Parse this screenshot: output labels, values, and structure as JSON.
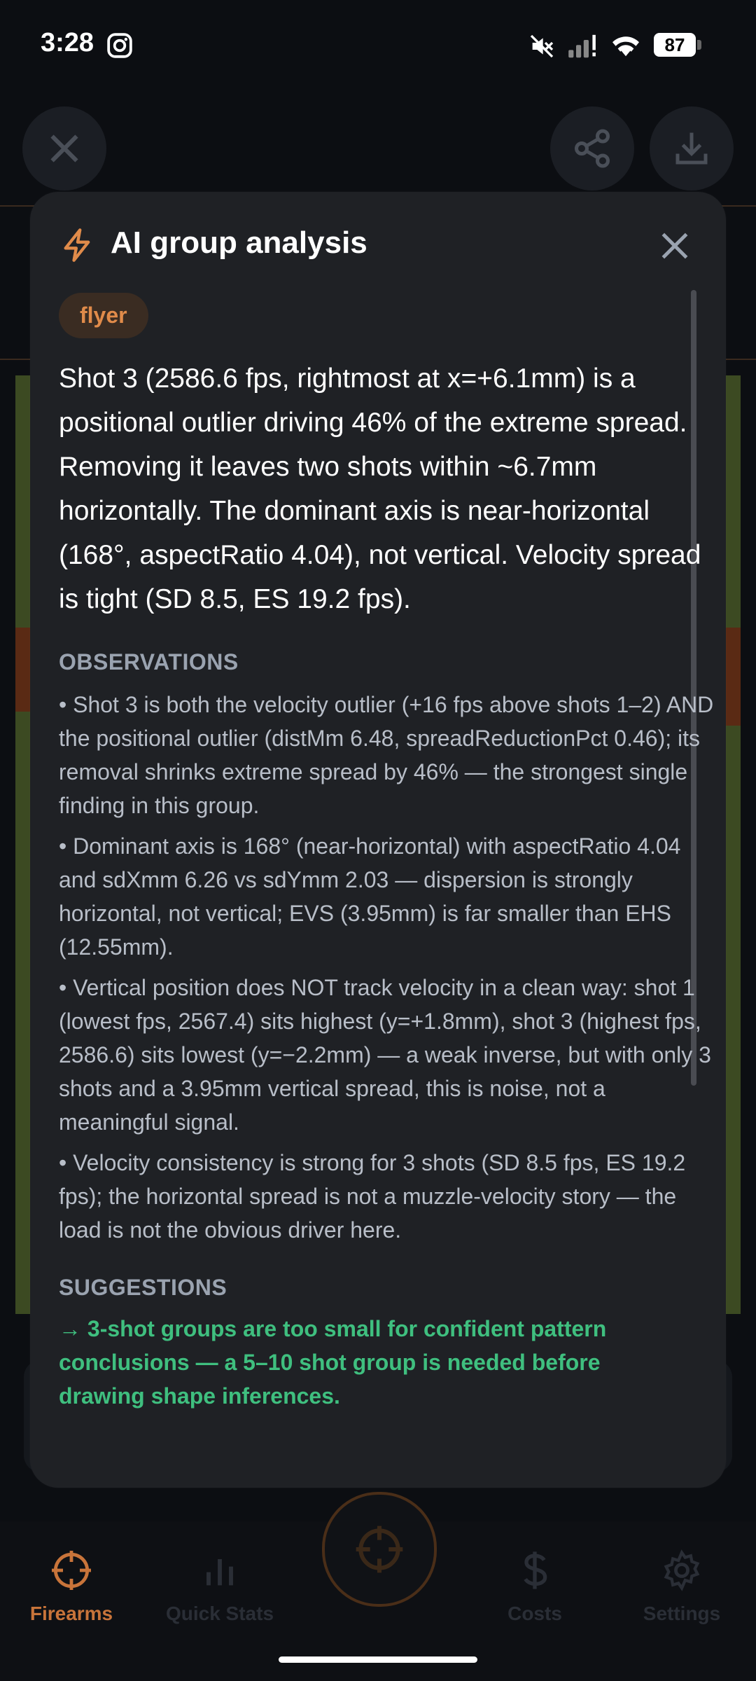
{
  "status": {
    "time": "3:28",
    "battery": "87"
  },
  "modal": {
    "title": "AI group analysis",
    "tag": "flyer",
    "summary": "Shot 3 (2586.6 fps, rightmost at x=+6.1mm) is a positional outlier driving 46% of the extreme spread. Removing it leaves two shots within ~6.7mm horizontally. The dominant axis is near-horizontal (168°, aspectRatio 4.04), not vertical. Velocity spread is tight (SD 8.5, ES 19.2 fps).",
    "observations_heading": "OBSERVATIONS",
    "observations": [
      "• Shot 3 is both the velocity outlier (+16 fps above shots 1–2) AND the positional outlier (distMm 6.48, spreadReductionPct 0.46); its removal shrinks extreme spread by 46% — the strongest single finding in this group.",
      "• Dominant axis is 168° (near-horizontal) with aspectRatio 4.04 and sdXmm 6.26 vs sdYmm 2.03 — dispersion is strongly horizontal, not vertical; EVS (3.95mm) is far smaller than EHS (12.55mm).",
      "• Vertical position does NOT track velocity in a clean way: shot 1 (lowest fps, 2567.4) sits highest (y=+1.8mm), shot 3 (highest fps, 2586.6) sits lowest (y=−2.2mm) — a weak inverse, but with only 3 shots and a 3.95mm vertical spread, this is noise, not a meaningful signal.",
      "• Velocity consistency is strong for 3 shots (SD 8.5 fps, ES 19.2 fps); the horizontal spread is not a muzzle-velocity story — the load is not the obvious driver here."
    ],
    "suggestions_heading": "SUGGESTIONS",
    "suggestions": [
      "→ 3-shot groups are too small for confident pattern conclusions — a 5–10 shot group is needed before drawing shape inferences."
    ]
  },
  "nav": {
    "items": [
      {
        "label": "Firearms",
        "color": "#c8743a"
      },
      {
        "label": "Quick Stats",
        "color": "#2a2e36"
      },
      {
        "label": "Costs",
        "color": "#2a2e36"
      },
      {
        "label": "Settings",
        "color": "#2a2e36"
      }
    ]
  },
  "colors": {
    "accent": "#e08b4a",
    "suggestion": "#3fbf7f",
    "modal_bg": "#1f2125"
  }
}
